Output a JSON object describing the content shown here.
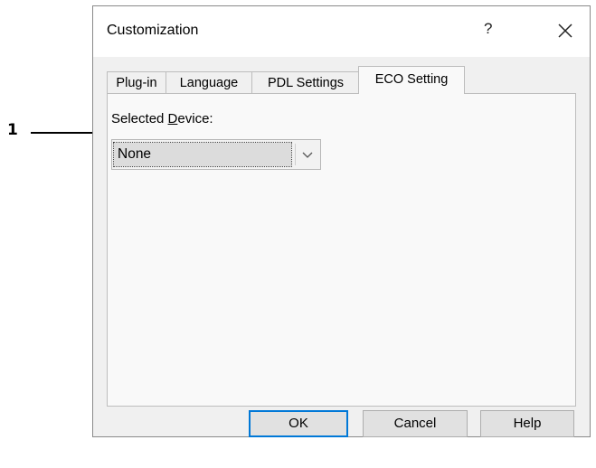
{
  "callout": {
    "number": "1"
  },
  "dialog": {
    "title": "Customization",
    "help_glyph": "?",
    "tabs": [
      {
        "label": "Plug-in",
        "active": false
      },
      {
        "label": "Language",
        "active": false
      },
      {
        "label": "PDL Settings",
        "active": false
      },
      {
        "label": "ECO Setting",
        "active": true
      }
    ],
    "selected_device": {
      "label_before": "Selected ",
      "label_accel": "D",
      "label_after": "evice:",
      "value": "None"
    },
    "buttons": {
      "ok": "OK",
      "cancel": "Cancel",
      "help": "Help"
    }
  }
}
